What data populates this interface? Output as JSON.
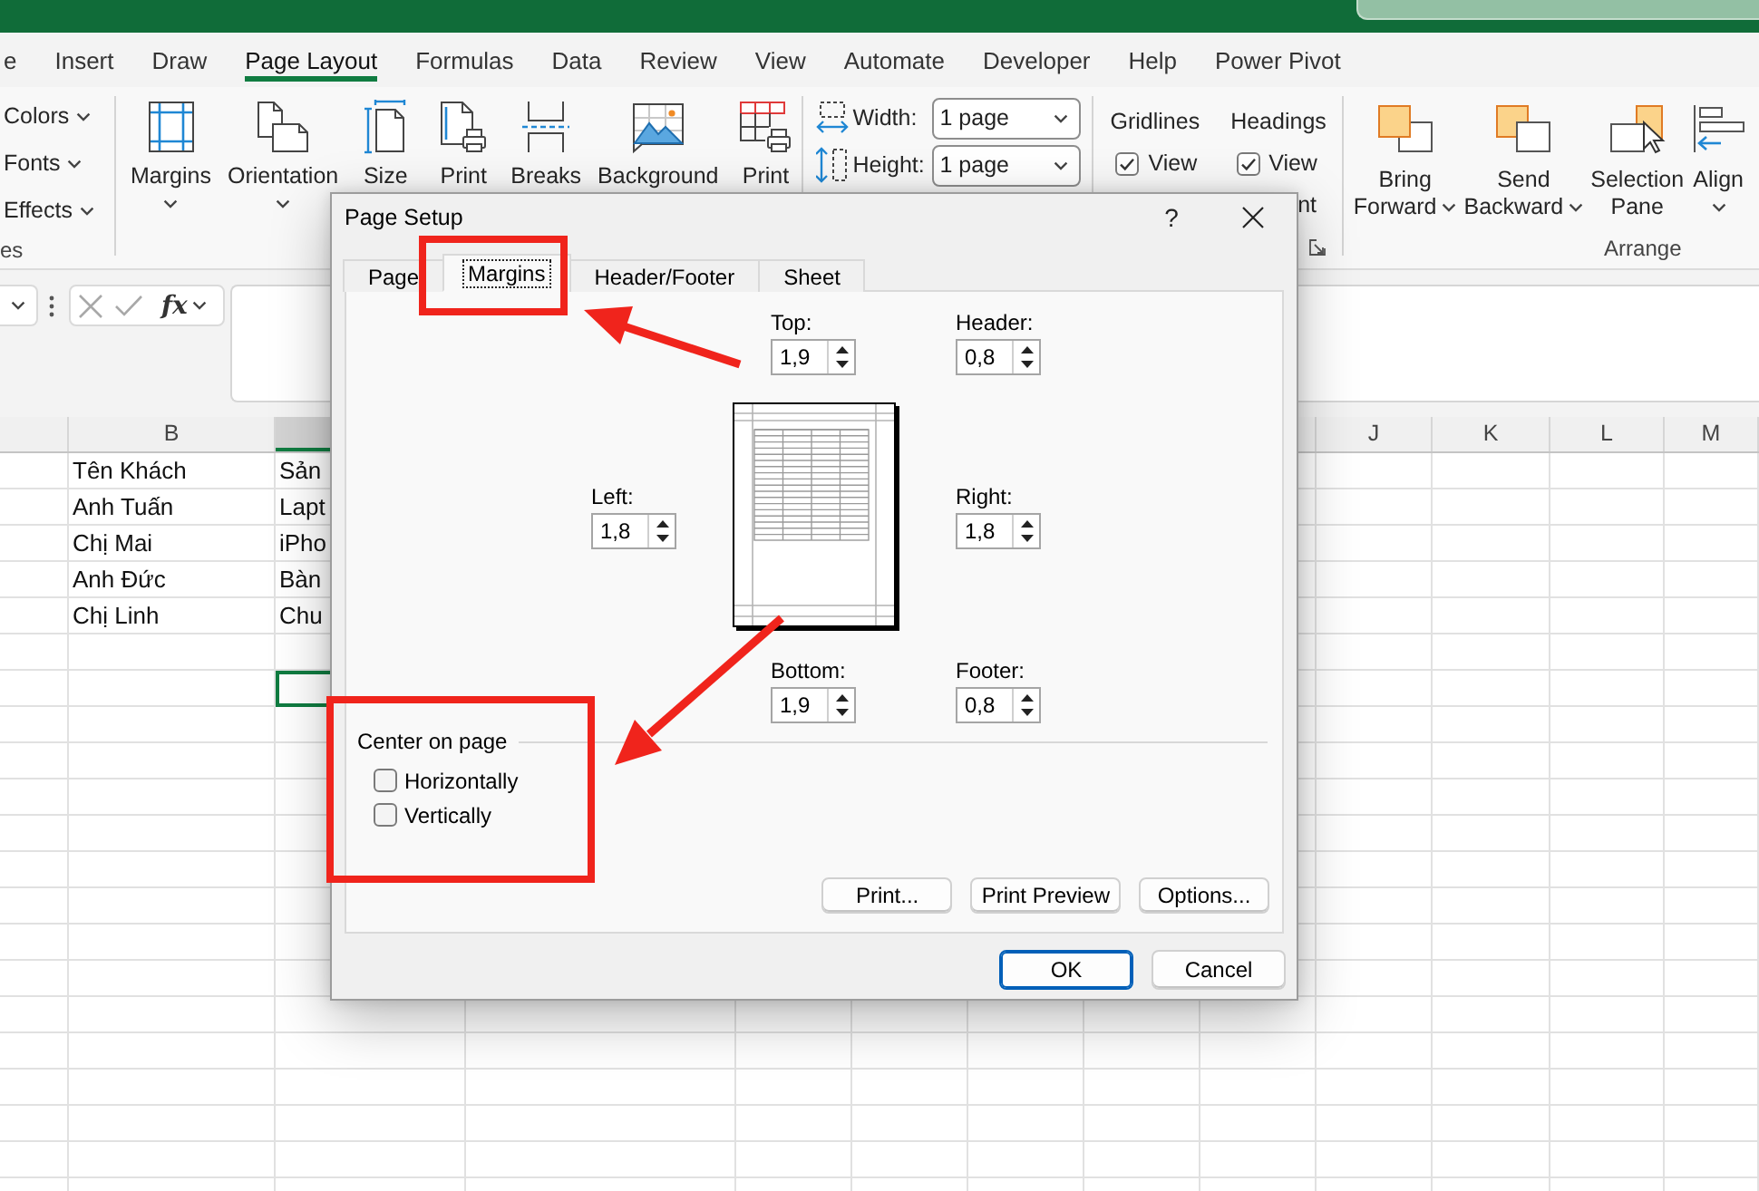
{
  "ribbon_tabs": [
    {
      "label": "e",
      "selected": false
    },
    {
      "label": "Insert",
      "selected": false
    },
    {
      "label": "Draw",
      "selected": false
    },
    {
      "label": "Page Layout",
      "selected": true
    },
    {
      "label": "Formulas",
      "selected": false
    },
    {
      "label": "Data",
      "selected": false
    },
    {
      "label": "Review",
      "selected": false
    },
    {
      "label": "View",
      "selected": false
    },
    {
      "label": "Automate",
      "selected": false
    },
    {
      "label": "Developer",
      "selected": false
    },
    {
      "label": "Help",
      "selected": false
    },
    {
      "label": "Power Pivot",
      "selected": false
    }
  ],
  "ribbon": {
    "themes": {
      "options": [
        "Colors",
        "Fonts",
        "Effects"
      ],
      "group_label": "es"
    },
    "page_setup": {
      "buttons": [
        {
          "kind": "margins",
          "label": "Margins",
          "dropdown": true
        },
        {
          "kind": "orientation",
          "label": "Orientation",
          "dropdown": true
        },
        {
          "kind": "size",
          "label": "Size",
          "dropdown": false
        },
        {
          "kind": "area",
          "label": "Print",
          "dropdown": false
        },
        {
          "kind": "breaks",
          "label": "Breaks",
          "dropdown": false
        },
        {
          "kind": "background",
          "label": "Background",
          "dropdown": false
        },
        {
          "kind": "titles",
          "label": "Print",
          "dropdown": false
        }
      ]
    },
    "scale_to_fit": [
      {
        "kind": "width",
        "label": "Width:",
        "value": "1 page"
      },
      {
        "kind": "height",
        "label": "Height:",
        "value": "1 page"
      }
    ],
    "sheet_options": {
      "gridlines": {
        "title": "Gridlines",
        "view": {
          "label": "View",
          "checked": true
        }
      },
      "headings": {
        "title": "Headings",
        "view": {
          "label": "View",
          "checked": true
        },
        "print": {
          "label": "nt"
        }
      }
    },
    "arrange": {
      "buttons": [
        {
          "kind": "bring",
          "lines": [
            "Bring",
            "Forward"
          ],
          "dropdown": true
        },
        {
          "kind": "send",
          "lines": [
            "Send",
            "Backward"
          ],
          "dropdown": true
        },
        {
          "kind": "selection",
          "lines": [
            "Selection",
            "Pane"
          ],
          "dropdown": false
        },
        {
          "kind": "align",
          "lines": [
            "Align"
          ],
          "dropdown": true
        }
      ],
      "group_label": "Arrange"
    }
  },
  "formula_bar": {
    "function_label": "fx"
  },
  "sheet": {
    "columns": [
      {
        "selected": false
      },
      {
        "label": "B",
        "selected": false
      },
      {
        "selected": true
      },
      {
        "selected": false
      },
      {
        "label": "J",
        "selected": false
      },
      {
        "label": "K",
        "selected": false
      },
      {
        "label": "L",
        "selected": false
      },
      {
        "label": "M",
        "selected": false
      }
    ],
    "rows": [
      {
        "cells": [
          {
            "text": "Tên Khách",
            "selected": false
          },
          {
            "text": "Sản",
            "selected": false
          }
        ]
      },
      {
        "cells": [
          {
            "text": "Anh Tuấn",
            "selected": false
          },
          {
            "text": "Lapt",
            "selected": false
          }
        ]
      },
      {
        "cells": [
          {
            "text": "Chị Mai",
            "selected": false
          },
          {
            "text": "iPho",
            "selected": false
          }
        ]
      },
      {
        "cells": [
          {
            "text": "Anh Đức",
            "selected": false
          },
          {
            "text": "Bàn",
            "selected": false
          }
        ]
      },
      {
        "cells": [
          {
            "text": "Chị Linh",
            "selected": false
          },
          {
            "text": "Chu",
            "selected": false
          }
        ]
      },
      {
        "cells": [
          {
            "selected": false
          },
          {
            "selected": false
          }
        ]
      },
      {
        "cells": [
          {
            "selected": false
          },
          {
            "selected": true
          }
        ]
      }
    ]
  },
  "dialog": {
    "title": "Page Setup",
    "help": "?",
    "tabs": [
      {
        "label": "Page",
        "selected": false
      },
      {
        "label": "Margins",
        "selected": true
      },
      {
        "label": "Header/Footer",
        "selected": false
      },
      {
        "label": "Sheet",
        "selected": false
      }
    ],
    "margins": {
      "top": {
        "label": "Top:",
        "value": "1,9"
      },
      "header": {
        "label": "Header:",
        "value": "0,8"
      },
      "left": {
        "label": "Left:",
        "value": "1,8"
      },
      "right": {
        "label": "Right:",
        "value": "1,8"
      },
      "bottom": {
        "label": "Bottom:",
        "value": "1,9"
      },
      "footer": {
        "label": "Footer:",
        "value": "0,8"
      }
    },
    "center_on_page": {
      "title": "Center on page",
      "options": [
        {
          "label": "Horizontally",
          "checked": false
        },
        {
          "label": "Vertically",
          "checked": false
        }
      ]
    },
    "panel_buttons": [
      "Print...",
      "Print Preview",
      "Options..."
    ],
    "buttons": [
      {
        "label": "OK",
        "default": true
      },
      {
        "label": "Cancel",
        "default": false
      }
    ]
  }
}
